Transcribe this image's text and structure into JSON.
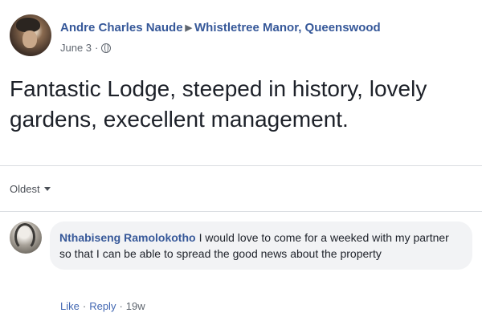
{
  "post": {
    "author": "Andre Charles Naude",
    "separator_icon": "triangle-right-icon",
    "place": "Whistletree Manor, Queenswood",
    "date": "June 3",
    "meta_dot": "·",
    "privacy_icon": "globe-icon",
    "text": "Fantastic Lodge, steeped in history, lovely gardens, execellent management."
  },
  "comments_sort": {
    "label": "Oldest",
    "icon": "caret-down-icon"
  },
  "comment": {
    "author": "Nthabiseng Ramolokotho",
    "text": "I would love to come for a weeked with my partner so that I can be able to spread the good news about the property",
    "actions": {
      "like": "Like",
      "dot1": "·",
      "reply": "Reply",
      "dot2": "·",
      "age": "19w"
    }
  },
  "colors": {
    "link_blue": "#365899",
    "action_blue": "#4267b2",
    "meta_gray": "#606770",
    "bubble_bg": "#f2f3f5"
  }
}
